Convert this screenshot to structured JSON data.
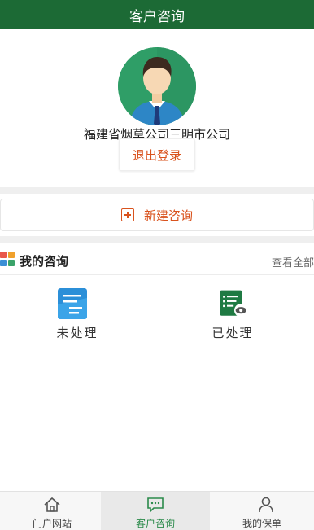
{
  "header": {
    "title": "客户咨询"
  },
  "profile": {
    "organization": "福建省烟草公司三明市公司",
    "logout_label": "退出登录"
  },
  "actions": {
    "new_consult_label": "新建咨询"
  },
  "my_consult": {
    "title": "我的咨询",
    "view_all_label": "查看全部",
    "cards": [
      {
        "label": "未处理",
        "icon": "document-list-icon"
      },
      {
        "label": "已处理",
        "icon": "document-viewed-icon"
      }
    ]
  },
  "tabbar": {
    "items": [
      {
        "label": "门户网站",
        "icon": "home-icon",
        "active": false
      },
      {
        "label": "客户咨询",
        "icon": "chat-icon",
        "active": true
      },
      {
        "label": "我的保单",
        "icon": "user-icon",
        "active": false
      }
    ]
  },
  "colors": {
    "brand_green": "#1c6a35",
    "accent_orange": "#d9531e",
    "active_green": "#2a8a4a"
  }
}
